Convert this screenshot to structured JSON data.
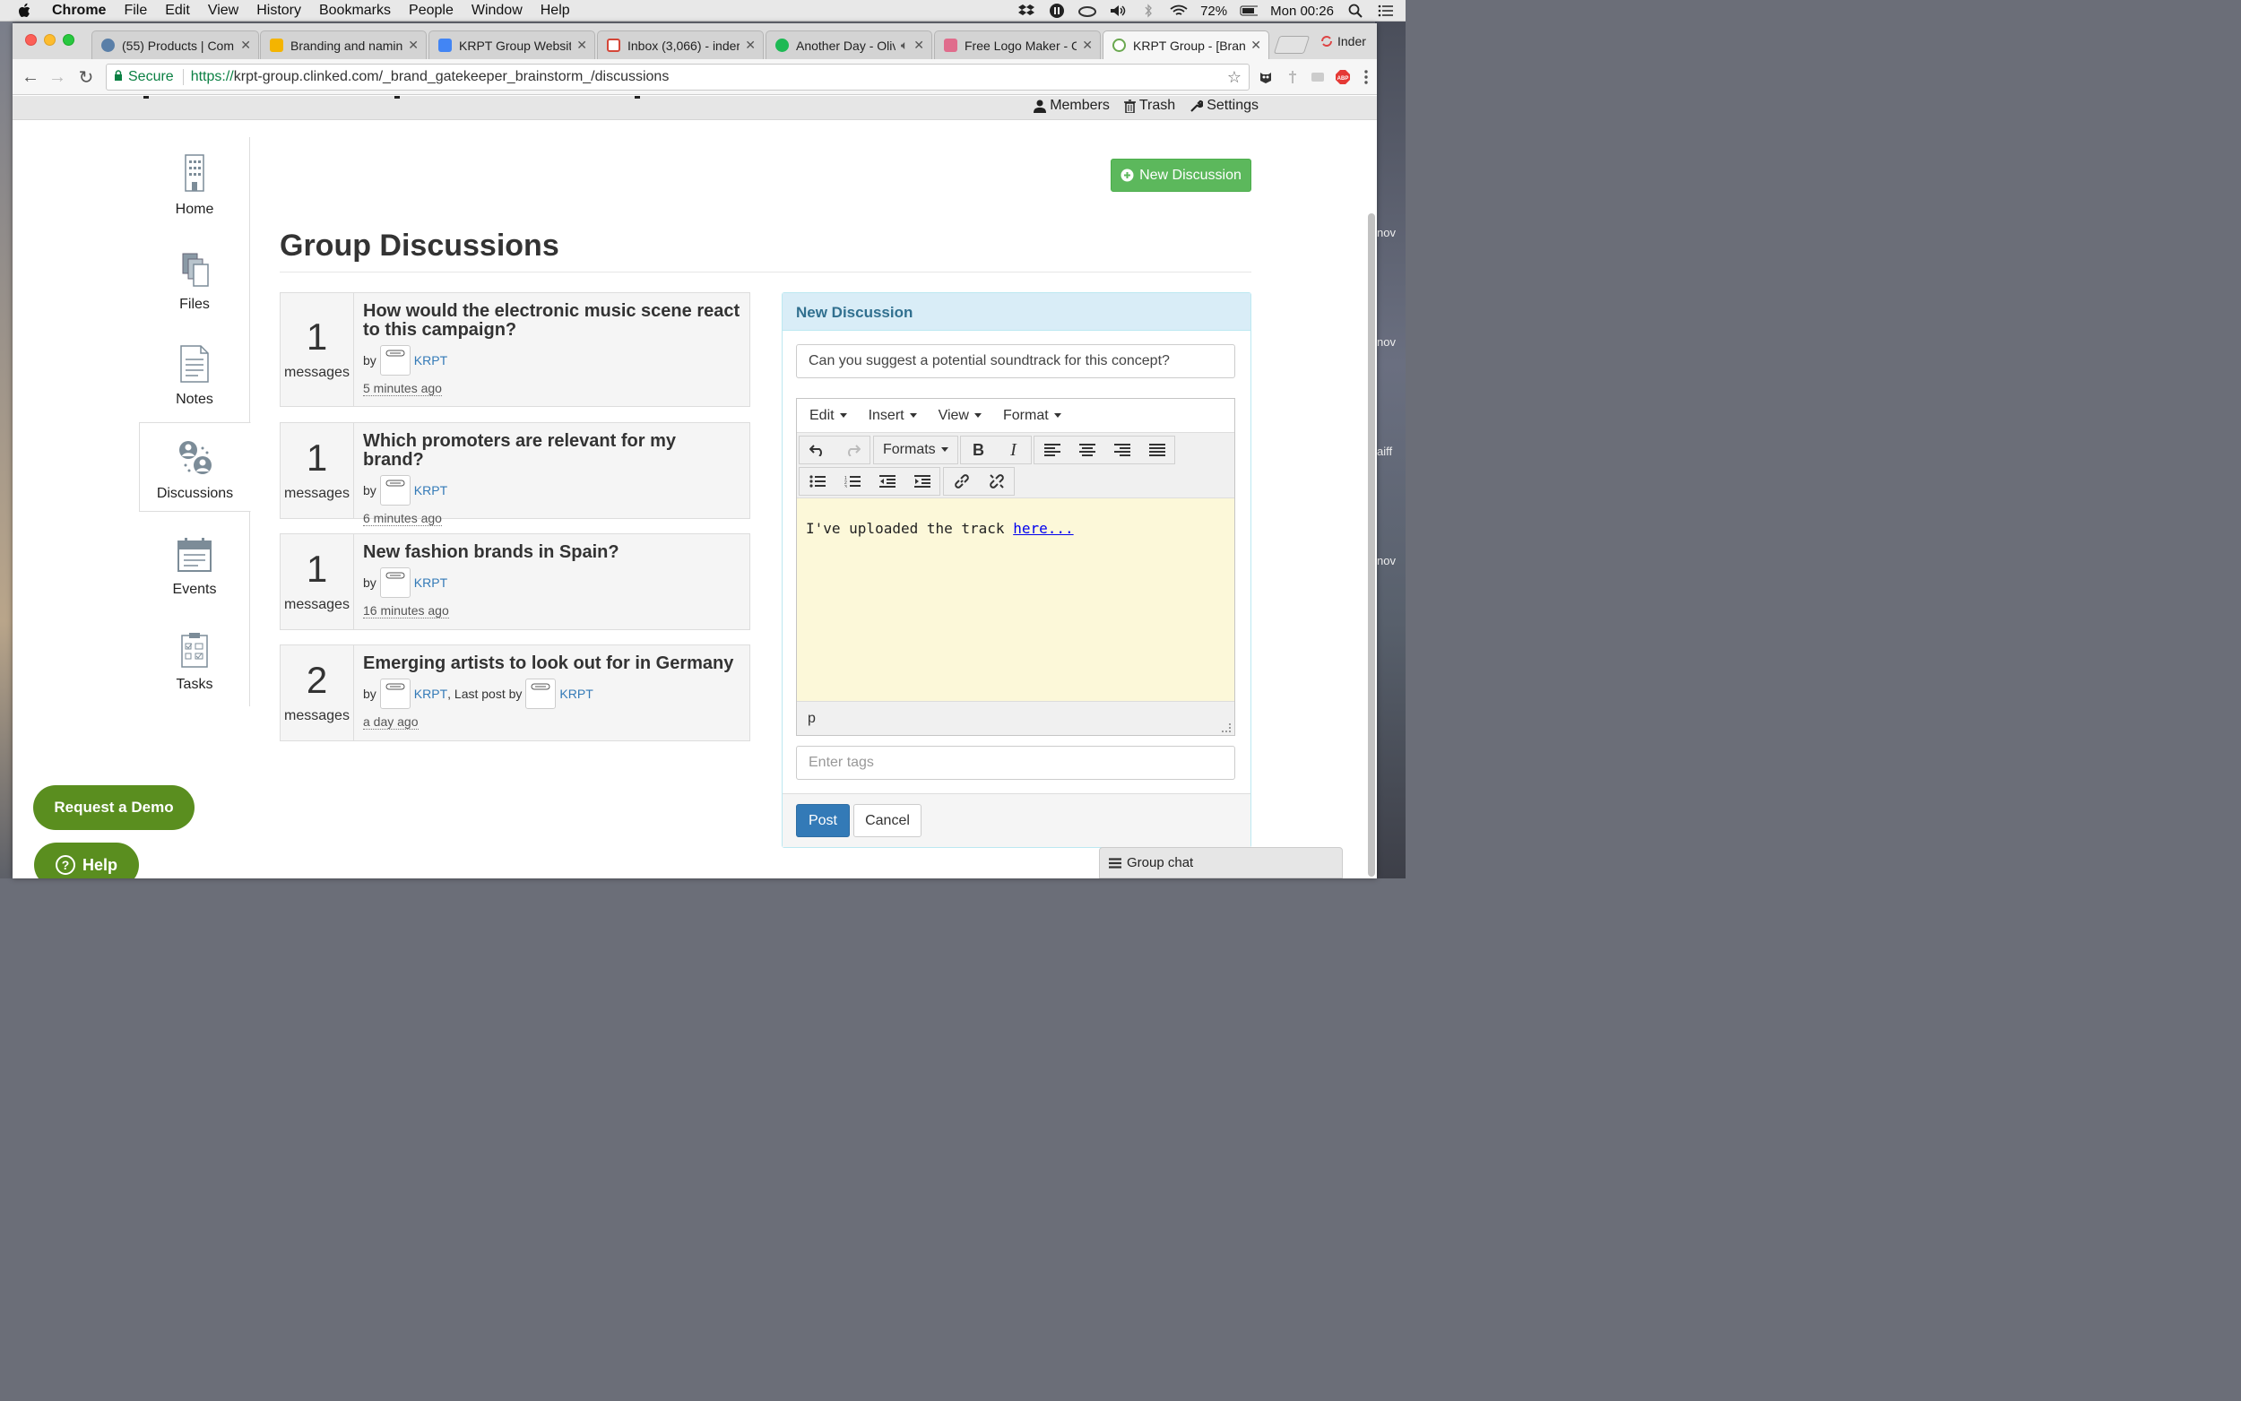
{
  "menubar": {
    "app": "Chrome",
    "items": [
      "File",
      "Edit",
      "View",
      "History",
      "Bookmarks",
      "People",
      "Window",
      "Help"
    ],
    "battery": "72%",
    "clock": "Mon 00:26"
  },
  "tabs": [
    {
      "title": "(55) Products | Com",
      "color": "#5a7fa8"
    },
    {
      "title": "Branding and naming",
      "color": "#f4b400"
    },
    {
      "title": "KRPT Group Website",
      "color": "#4285f4"
    },
    {
      "title": "Inbox (3,066) - inder",
      "color": "#d44638"
    },
    {
      "title": "Another Day - Oliv",
      "color": "#1db954"
    },
    {
      "title": "Free Logo Maker - C",
      "color": "#e06c8c"
    },
    {
      "title": "KRPT Group - [Branc",
      "color": "#6aa84f"
    }
  ],
  "profile_name": "Inder",
  "address": {
    "secure_label": "Secure",
    "scheme": "https://",
    "rest": "krpt-group.clinked.com/_brand_gatekeeper_brainstorm_/discussions"
  },
  "topnav": {
    "members": "Members",
    "trash": "Trash",
    "settings": "Settings"
  },
  "sidebar": [
    {
      "label": "Home"
    },
    {
      "label": "Files"
    },
    {
      "label": "Notes"
    },
    {
      "label": "Discussions"
    },
    {
      "label": "Events"
    },
    {
      "label": "Tasks"
    }
  ],
  "new_discussion_button": "New Discussion",
  "page_title": "Group Discussions",
  "discussions": [
    {
      "count": "1",
      "unit": "messages",
      "title": "How would the electronic music scene react to this campaign?",
      "by": "by",
      "author": "KRPT",
      "time": "5 minutes ago"
    },
    {
      "count": "1",
      "unit": "messages",
      "title": "Which promoters are relevant for my brand?",
      "by": "by",
      "author": "KRPT",
      "time": "6 minutes ago"
    },
    {
      "count": "1",
      "unit": "messages",
      "title": "New fashion brands in Spain?",
      "by": "by",
      "author": "KRPT",
      "time": "16 minutes ago"
    },
    {
      "count": "2",
      "unit": "messages",
      "title": "Emerging artists to look out for in Germany",
      "by": "by",
      "author": "KRPT",
      "last_post_label": ", Last post by",
      "last_author": "KRPT",
      "time": "a day ago"
    }
  ],
  "panel": {
    "heading": "New Discussion",
    "subject_value": "Can you suggest a potential soundtrack for this concept?",
    "editor_menu": [
      "Edit",
      "Insert",
      "View",
      "Format"
    ],
    "formats_label": "Formats",
    "content_text": "I've uploaded the track ",
    "content_link": "here...",
    "status_path": "p",
    "tags_placeholder": "Enter tags",
    "post_label": "Post",
    "cancel_label": "Cancel"
  },
  "request_demo": "Request a Demo",
  "help": "Help",
  "group_chat": "Group chat",
  "desktop_labels": [
    "nov",
    "nov",
    "aiff",
    "nov"
  ]
}
